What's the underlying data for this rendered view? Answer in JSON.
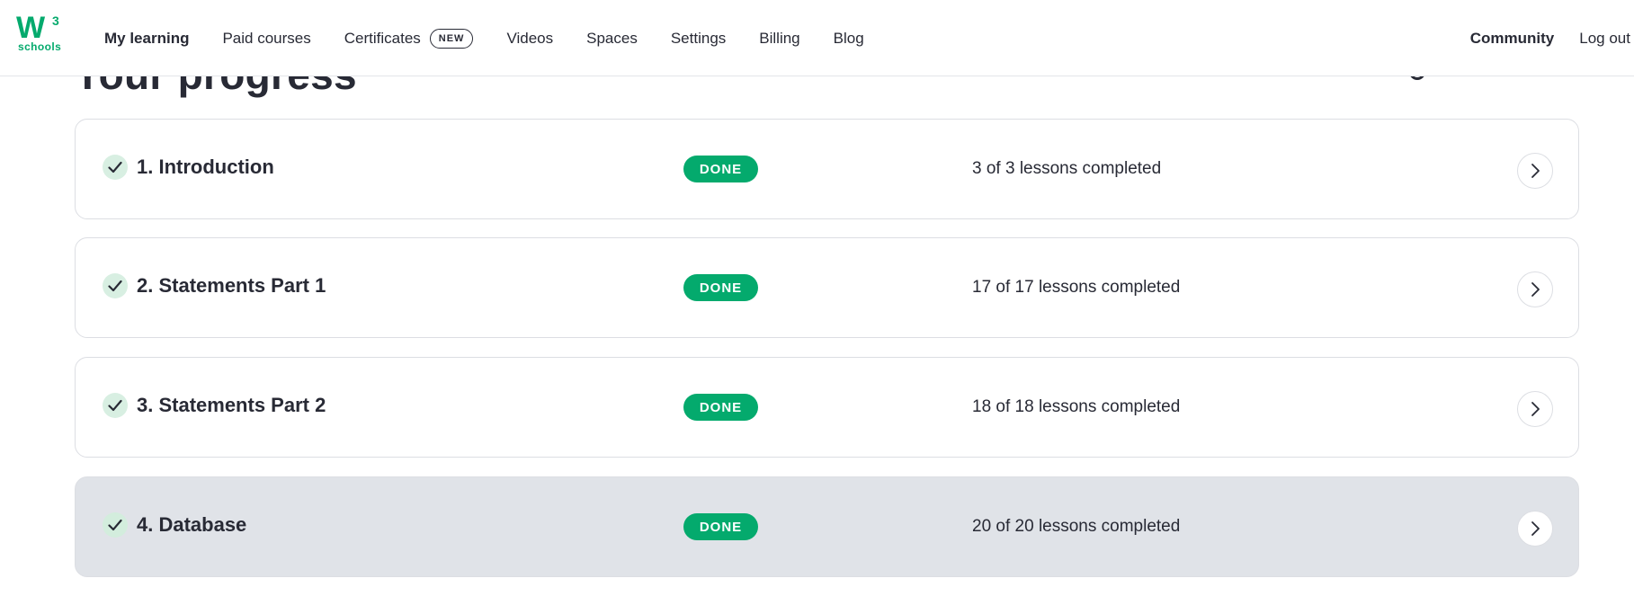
{
  "logo": {
    "mark": "W",
    "superscript": "3",
    "sub": "schools"
  },
  "nav": {
    "items": [
      {
        "label": "My learning",
        "active": true
      },
      {
        "label": "Paid courses"
      },
      {
        "label": "Certificates",
        "badge": "NEW"
      },
      {
        "label": "Videos"
      },
      {
        "label": "Spaces"
      },
      {
        "label": "Settings"
      },
      {
        "label": "Billing"
      },
      {
        "label": "Blog"
      }
    ],
    "community": "Community",
    "logout": "Log out"
  },
  "page": {
    "heading": "Your progress"
  },
  "colors": {
    "accent": "#04aa6d",
    "text": "#282a35",
    "highlight_bg": "#e0e3e8"
  },
  "modules": [
    {
      "title": "1. Introduction",
      "status": "DONE",
      "progress": "3 of 3 lessons completed",
      "icon": "checkmark-icon"
    },
    {
      "title": "2. Statements Part 1",
      "status": "DONE",
      "progress": "17 of 17 lessons completed",
      "icon": "checkmark-icon"
    },
    {
      "title": "3. Statements Part 2",
      "status": "DONE",
      "progress": "18 of 18 lessons completed",
      "icon": "checkmark-icon"
    },
    {
      "title": "4. Database",
      "status": "DONE",
      "progress": "20 of 20 lessons completed",
      "icon": "checkmark-icon",
      "highlighted": true
    }
  ]
}
